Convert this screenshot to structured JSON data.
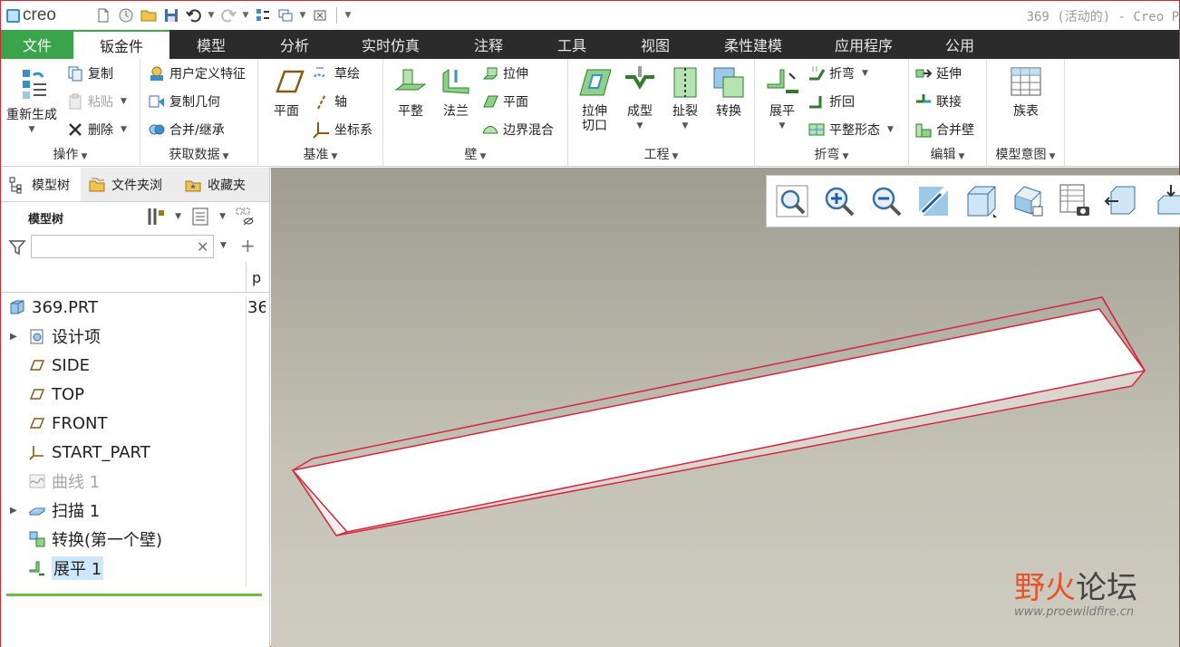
{
  "title_bar": {
    "logo_text": "creo",
    "window_title": "369 (活动的) - Creo P"
  },
  "tabs": [
    {
      "label": "文件"
    },
    {
      "label": "钣金件"
    },
    {
      "label": "模型"
    },
    {
      "label": "分析"
    },
    {
      "label": "实时仿真"
    },
    {
      "label": "注释"
    },
    {
      "label": "工具"
    },
    {
      "label": "视图"
    },
    {
      "label": "柔性建模"
    },
    {
      "label": "应用程序"
    },
    {
      "label": "公用"
    }
  ],
  "ribbon": {
    "operations": {
      "label": "操作",
      "regenerate": "重新生成",
      "copy": "复制",
      "paste": "粘贴",
      "delete": "删除"
    },
    "get_data": {
      "label": "获取数据",
      "udf": "用户定义特征",
      "copy_geometry": "复制几何",
      "merge_inherit": "合并/继承"
    },
    "datum": {
      "label": "基准",
      "plane": "平面",
      "sketch": "草绘",
      "axis": "轴",
      "csys": "坐标系"
    },
    "wall": {
      "label": "壁",
      "planar": "平整",
      "flange": "法兰",
      "extrude": "拉伸",
      "plane": "平面",
      "boundary_blend": "边界混合"
    },
    "engineering": {
      "label": "工程",
      "extrude_cut_line1": "拉伸",
      "extrude_cut_line2": "切口",
      "form": "成型",
      "rip": "扯裂",
      "convert": "转换"
    },
    "bend": {
      "label": "折弯",
      "unbend": "展平",
      "bend": "折弯",
      "bend_back": "折回",
      "flat_state": "平整形态"
    },
    "edit": {
      "label": "编辑",
      "extend": "延伸",
      "join": "联接",
      "merge_walls": "合并壁"
    },
    "model_intent": {
      "label": "模型意图",
      "family_table": "族表"
    }
  },
  "left_panel": {
    "tabs": [
      {
        "label": "模型树"
      },
      {
        "label": "文件夹浏"
      },
      {
        "label": "收藏夹"
      }
    ],
    "tree_header": "模型树",
    "filter": {
      "value": "",
      "placeholder": ""
    },
    "column_header": "p",
    "items": [
      {
        "label": "369.PRT",
        "col": "36"
      },
      {
        "label": "设计项"
      },
      {
        "label": "SIDE"
      },
      {
        "label": "TOP"
      },
      {
        "label": "FRONT"
      },
      {
        "label": "START_PART"
      },
      {
        "label": "曲线 1"
      },
      {
        "label": "扫描 1"
      },
      {
        "label": "转换(第一个壁)"
      },
      {
        "label": "展平 1"
      }
    ]
  },
  "watermark": {
    "text_left": "野火",
    "text_right": "论坛",
    "url": "www.proewildfire.cn"
  },
  "colors": {
    "accent_green": "#3aa44b",
    "tab_bar": "#2b2b2b",
    "edge_highlight": "#d7263d",
    "selection": "#cde8fb"
  }
}
